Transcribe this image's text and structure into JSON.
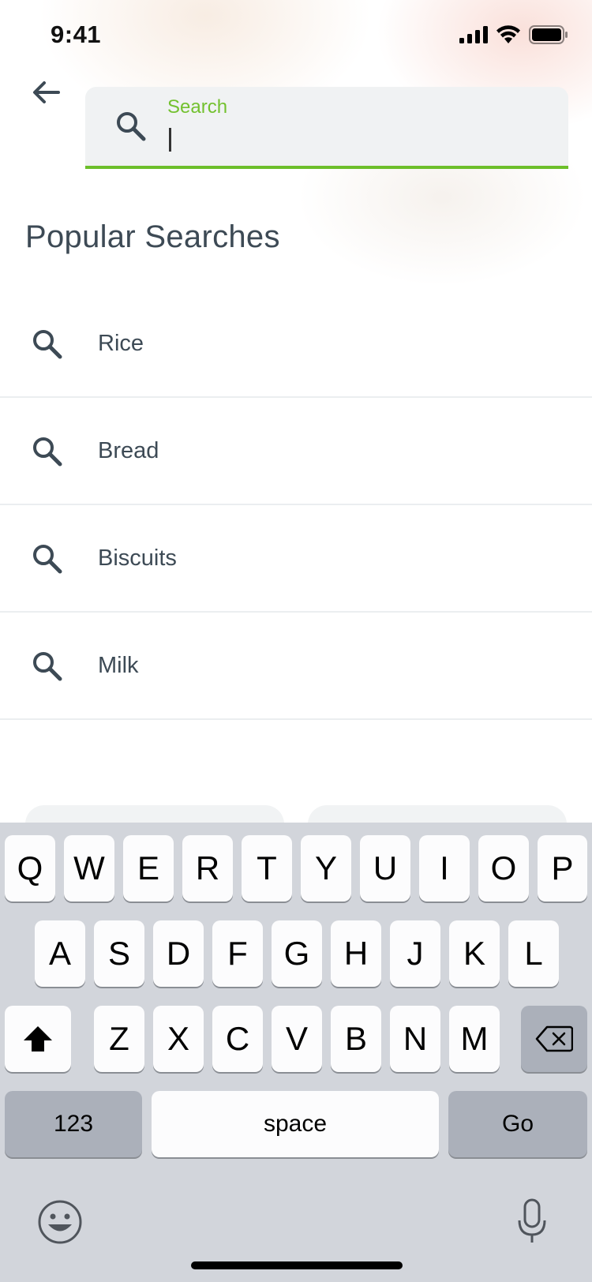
{
  "status_bar": {
    "time": "9:41"
  },
  "search": {
    "label": "Search",
    "value": ""
  },
  "section_title": "Popular Searches",
  "popular": [
    {
      "label": "Rice"
    },
    {
      "label": "Bread"
    },
    {
      "label": "Biscuits"
    },
    {
      "label": "Milk"
    }
  ],
  "keyboard": {
    "row1": [
      "Q",
      "W",
      "E",
      "R",
      "T",
      "Y",
      "U",
      "I",
      "O",
      "P"
    ],
    "row2": [
      "A",
      "S",
      "D",
      "F",
      "G",
      "H",
      "J",
      "K",
      "L"
    ],
    "row3": [
      "Z",
      "X",
      "C",
      "V",
      "B",
      "N",
      "M"
    ],
    "numbers_label": "123",
    "space_label": "space",
    "go_label": "Go"
  },
  "colors": {
    "accent": "#6cbf2a",
    "text": "#3d4a55",
    "keyboard_bg": "#d2d5db"
  }
}
